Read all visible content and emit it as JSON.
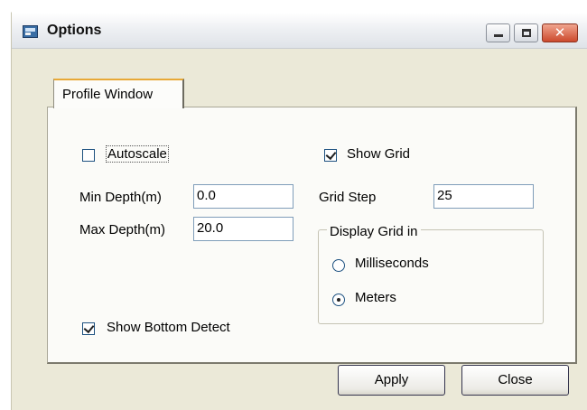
{
  "window": {
    "title": "Options",
    "icon": "app-window-icon",
    "caption_buttons": [
      "minimize-icon",
      "maximize-icon",
      "close-icon"
    ],
    "close_glyph": "✕"
  },
  "tabs": [
    {
      "label": "Profile Window",
      "selected": true
    }
  ],
  "profile": {
    "autoscale": {
      "label": "Autoscale",
      "checked": false
    },
    "min_depth": {
      "label": "Min Depth(m)",
      "value": "0.0"
    },
    "max_depth": {
      "label": "Max Depth(m)",
      "value": "20.0"
    },
    "show_bottom_detect": {
      "label": "Show Bottom Detect",
      "checked": true
    },
    "show_grid": {
      "label": "Show Grid",
      "checked": true
    },
    "grid_step": {
      "label": "Grid Step",
      "value": "25"
    },
    "display_grid_in": {
      "legend": "Display Grid in",
      "options": [
        {
          "label": "Milliseconds",
          "selected": false
        },
        {
          "label": "Meters",
          "selected": true
        }
      ]
    }
  },
  "buttons": {
    "apply": "Apply",
    "close": "Close"
  },
  "colors": {
    "dialog_background": "#ebe9d8",
    "panel_background": "#fbfbf8",
    "tab_accent": "#e8a937",
    "close_button": "#cc4a2d"
  }
}
